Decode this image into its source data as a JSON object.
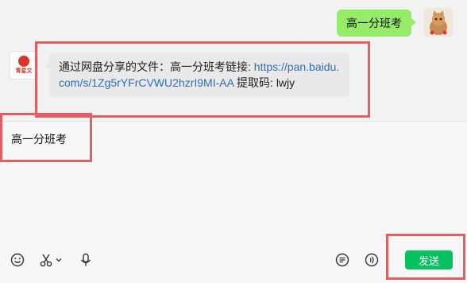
{
  "messages": {
    "outgoing": {
      "text": "高一分班考"
    },
    "incoming": {
      "prefix": "通过网盘分享的文件：高一分班考链接: ",
      "link": "https://pan.baidu.com/s/1Zg5rYFrCVWU2hzrI9MI-AA",
      "suffix": " 提取码: lwjy",
      "sender_brand": "青星文"
    }
  },
  "composer": {
    "text": "高一分班考",
    "send_label": "发送"
  },
  "toolbar": {
    "left_icons": [
      "emoji-icon",
      "scissors-icon",
      "chevron-down-icon",
      "microphone-icon"
    ],
    "right_icons": [
      "chat-history-icon",
      "voice-call-icon"
    ]
  },
  "colors": {
    "outgoing_bubble": "#95ec69",
    "incoming_bubble": "#e9e9ec",
    "link": "#2f6fb5",
    "send_button": "#07c160",
    "annotation": "#e05f62"
  }
}
